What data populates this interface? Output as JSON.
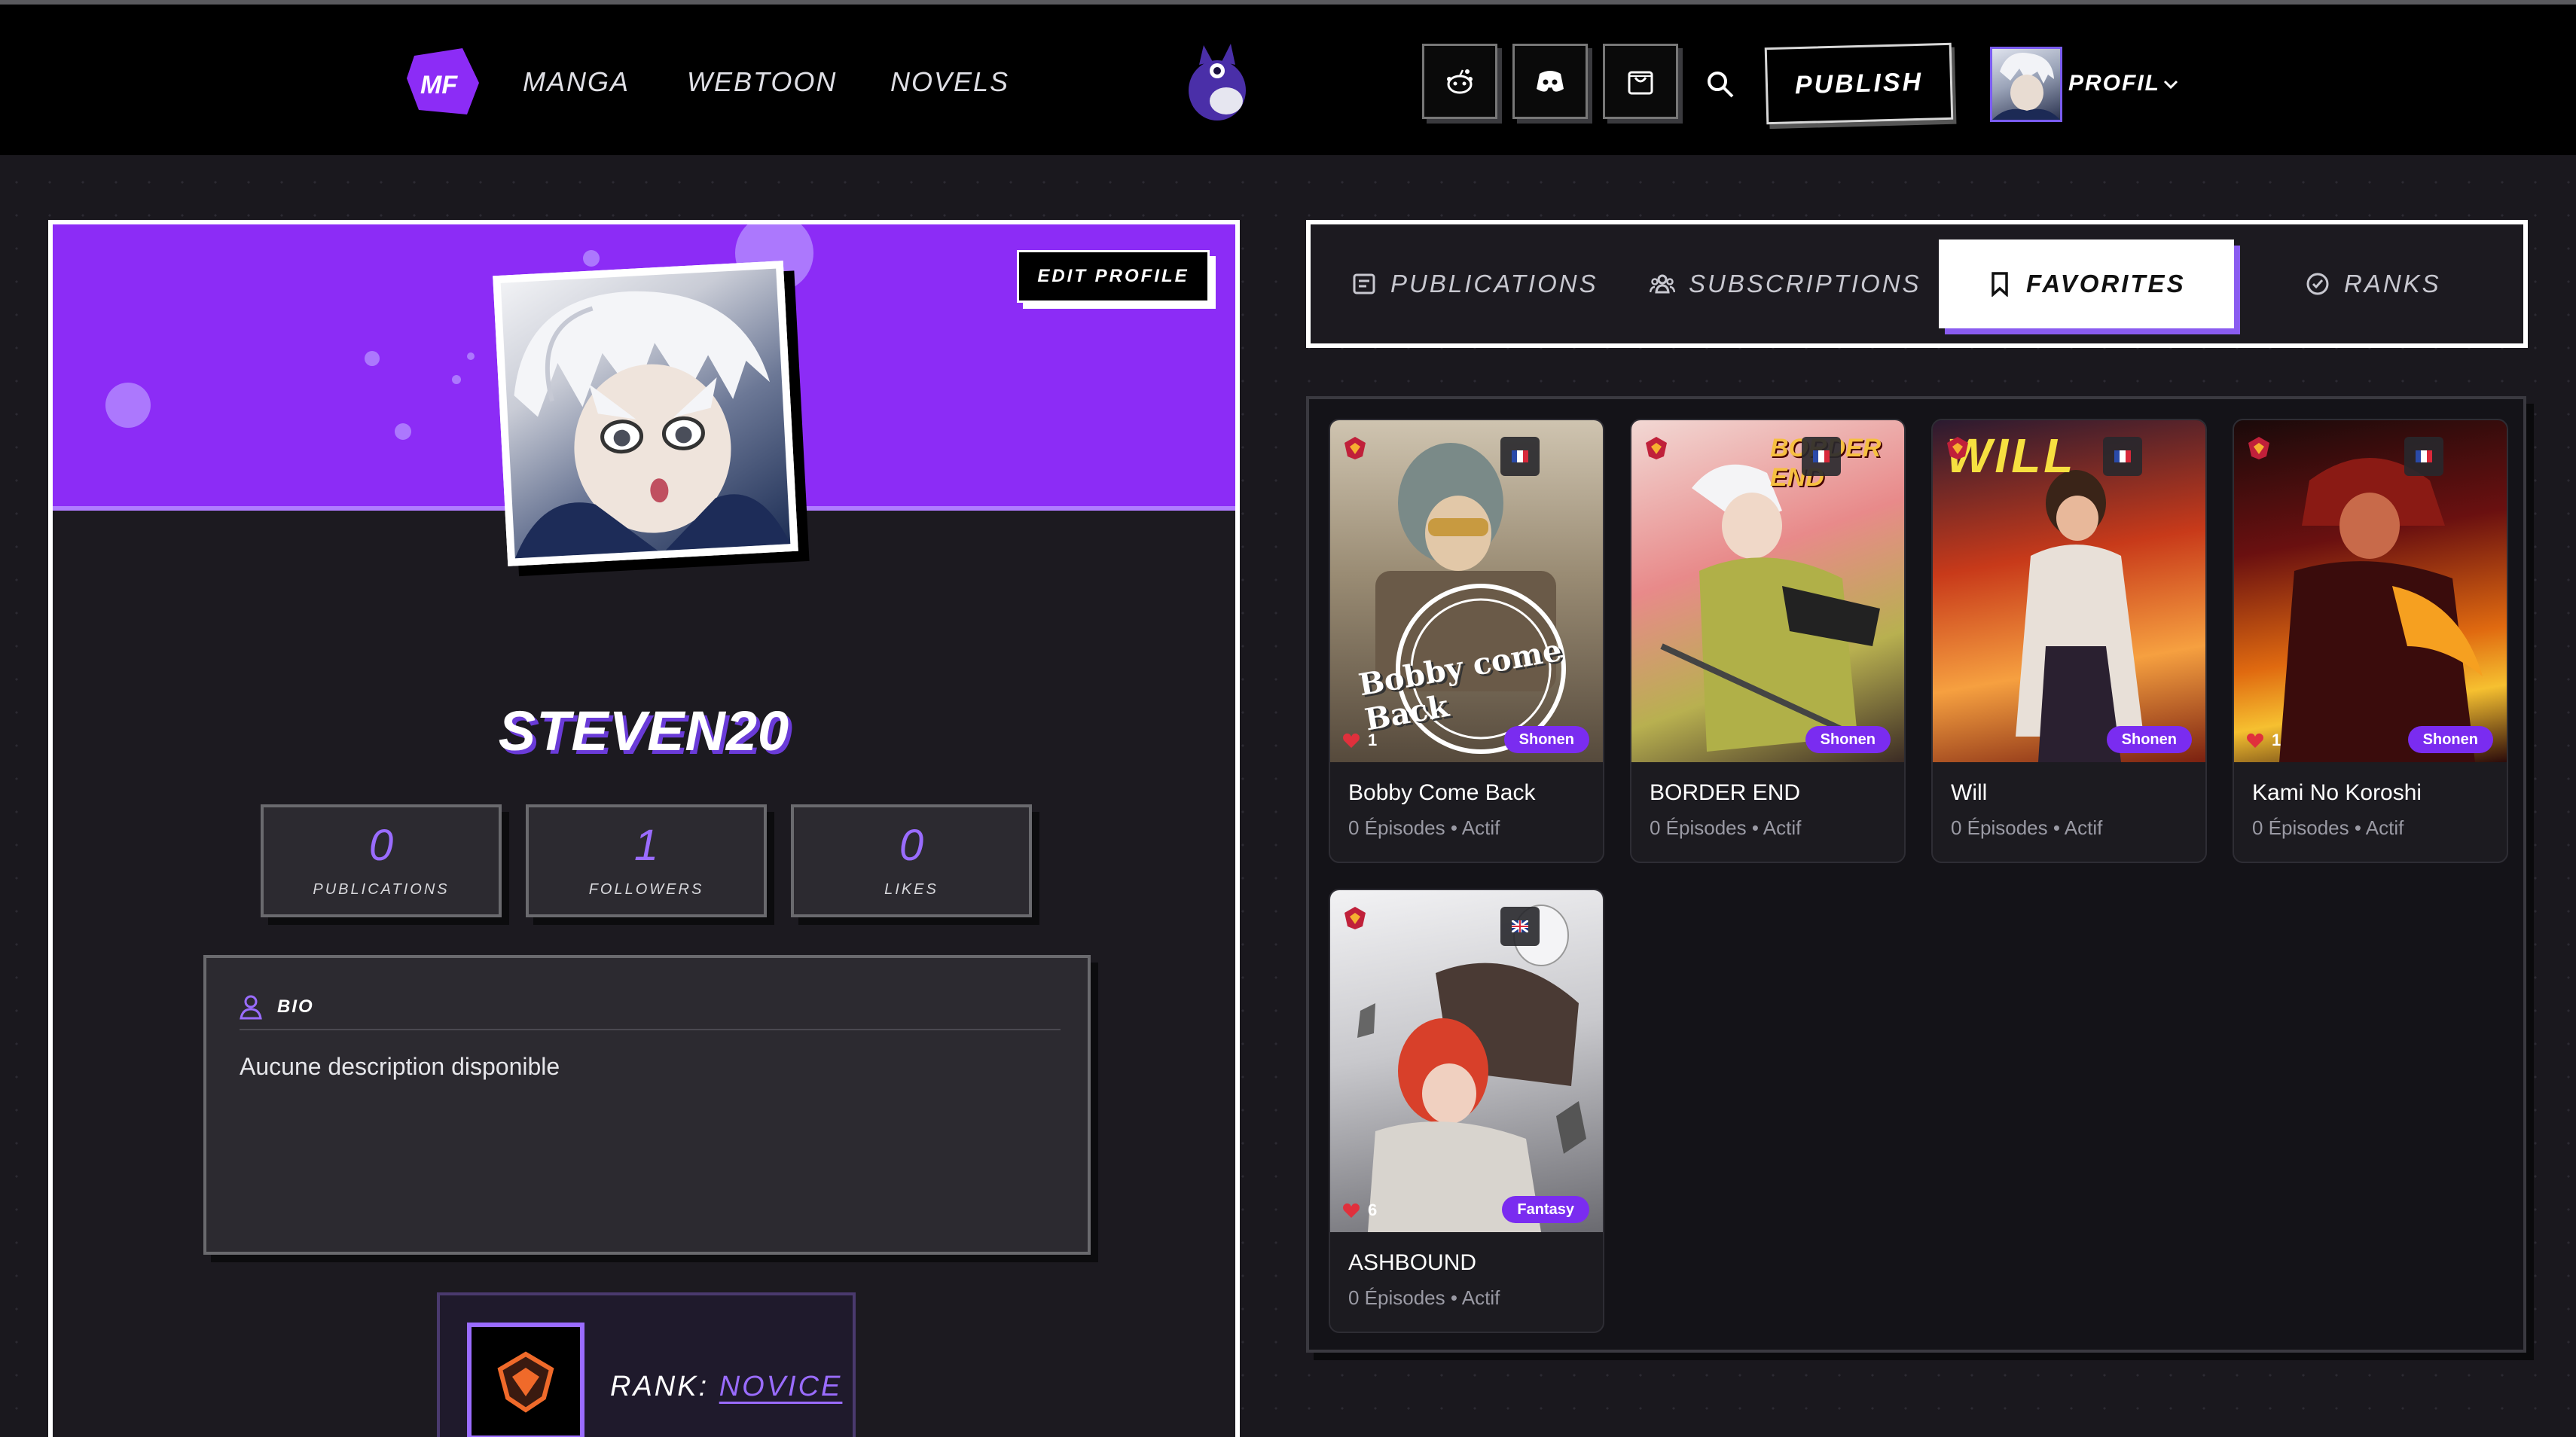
{
  "nav": {
    "logo_text": "MF",
    "links": [
      "MANGA",
      "WEBTOON",
      "NOVELS"
    ],
    "publish_label": "PUBLISH",
    "profile_label": "PROFIL"
  },
  "profile": {
    "edit_label": "EDIT PROFILE",
    "username": "STEVEN20",
    "stats": [
      {
        "value": "0",
        "label": "PUBLICATIONS"
      },
      {
        "value": "1",
        "label": "FOLLOWERS"
      },
      {
        "value": "0",
        "label": "LIKES"
      }
    ],
    "bio_label": "BIO",
    "bio_text": "Aucune description disponible",
    "rank_prefix": "RANK:",
    "rank_value": "NOVICE"
  },
  "tabs": [
    {
      "label": "PUBLICATIONS",
      "active": false
    },
    {
      "label": "SUBSCRIPTIONS",
      "active": false
    },
    {
      "label": "FAVORITES",
      "active": true
    },
    {
      "label": "RANKS",
      "active": false
    }
  ],
  "favorites": [
    {
      "title": "Bobby Come Back",
      "meta": "0 Épisodes • Actif",
      "genre": "Shonen",
      "likes": "1",
      "flag": "fr",
      "cover_text": "Bobby come Back"
    },
    {
      "title": "BORDER END",
      "meta": "0 Épisodes • Actif",
      "genre": "Shonen",
      "likes": "",
      "flag": "fr",
      "cover_text": "BORDER END"
    },
    {
      "title": "Will",
      "meta": "0 Épisodes • Actif",
      "genre": "Shonen",
      "likes": "",
      "flag": "fr",
      "cover_text": "WILL"
    },
    {
      "title": "Kami No Koroshi",
      "meta": "0 Épisodes • Actif",
      "genre": "Shonen",
      "likes": "1",
      "flag": "fr",
      "cover_text": ""
    },
    {
      "title": "ASHBOUND",
      "meta": "0 Épisodes • Actif",
      "genre": "Fantasy",
      "likes": "6",
      "flag": "uk",
      "cover_text": ""
    }
  ],
  "colors": {
    "accent": "#8c2cf6",
    "accent_light": "#9a6cff",
    "genre_badge": "#7a2cf0",
    "like_heart": "#e0303c"
  }
}
